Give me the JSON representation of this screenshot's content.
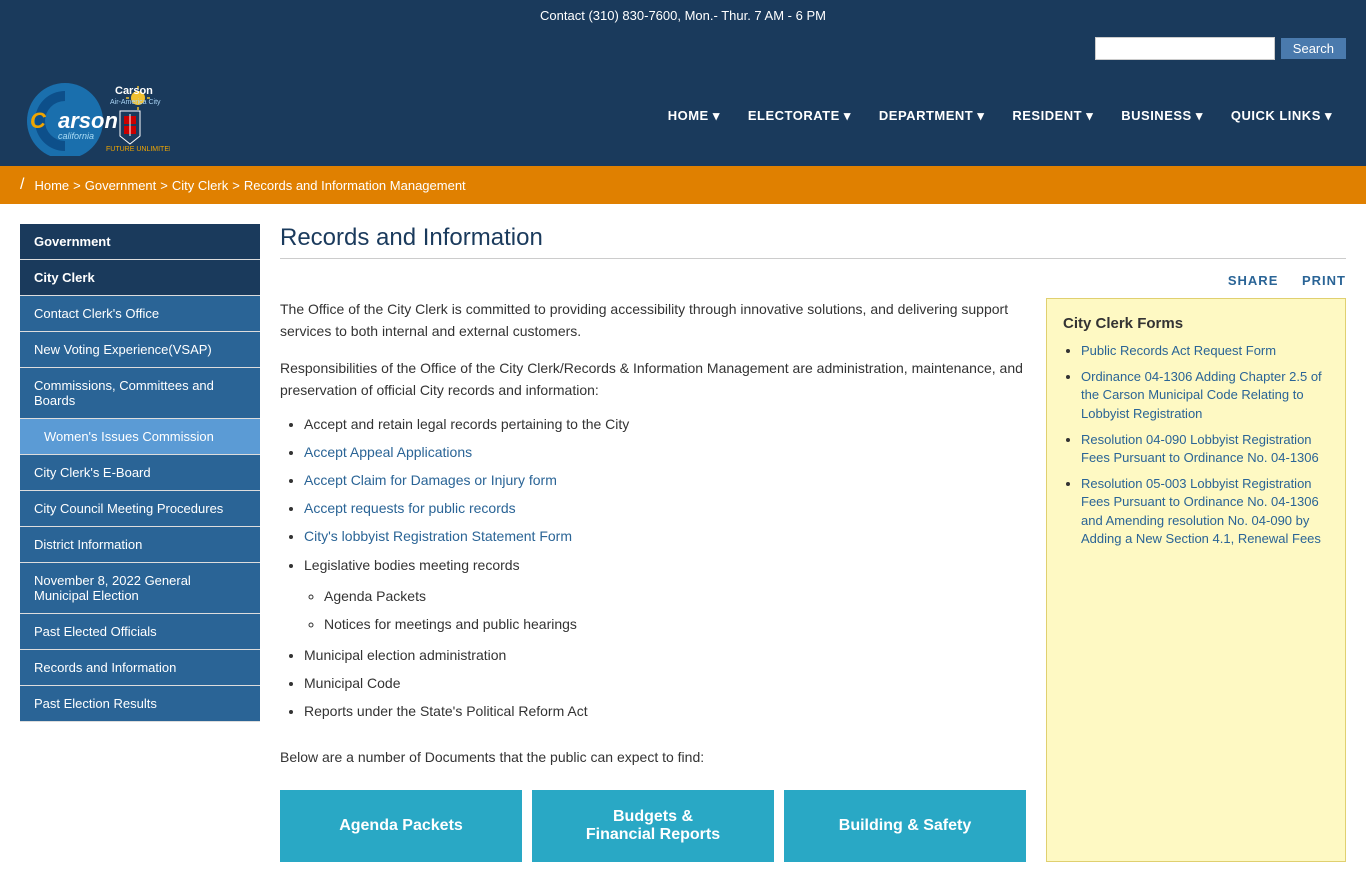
{
  "topbar": {
    "contact": "Contact (310) 830-7600, Mon.- Thur. 7 AM - 6 PM"
  },
  "search": {
    "placeholder": "",
    "button_label": "Search"
  },
  "nav": {
    "items": [
      {
        "label": "HOME □"
      },
      {
        "label": "ELECTORATE □"
      },
      {
        "label": "DEPARTMENT □"
      },
      {
        "label": "RESIDENT □"
      },
      {
        "label": "BUSINESS □"
      },
      {
        "label": "QUICK LINKS □"
      }
    ]
  },
  "breadcrumb": {
    "slash": "/",
    "items": [
      "Home",
      ">",
      "Government",
      ">",
      "City Clerk",
      ">",
      "Records and Information Management"
    ]
  },
  "sidebar": {
    "header": "Government",
    "items": [
      {
        "label": "City Clerk",
        "type": "active"
      },
      {
        "label": "Contact Clerk's Office",
        "type": "normal"
      },
      {
        "label": "New Voting Experience(VSAP)",
        "type": "normal"
      },
      {
        "label": "Commissions, Committees and Boards",
        "type": "normal"
      },
      {
        "label": "Women's Issues Commission",
        "type": "sub"
      },
      {
        "label": "City Clerk's E-Board",
        "type": "normal"
      },
      {
        "label": "City Council Meeting Procedures",
        "type": "normal"
      },
      {
        "label": "District Information",
        "type": "normal"
      },
      {
        "label": "November 8, 2022 General Municipal Election",
        "type": "normal"
      },
      {
        "label": "Past Elected Officials",
        "type": "normal"
      },
      {
        "label": "Records and Information",
        "type": "normal"
      },
      {
        "label": "Past Election Results",
        "type": "normal"
      }
    ]
  },
  "main": {
    "title": "Records and Information",
    "share_label": "SHARE",
    "print_label": "PRINT",
    "intro": "The Office of the City Clerk is committed to providing accessibility through innovative solutions, and delivering support services to both internal and external customers.",
    "responsibilities_intro": "Responsibilities of the Office of the City Clerk/Records & Information Management are administration, maintenance, and preservation of official City records and information:",
    "responsibilities": [
      {
        "text": "Accept and retain legal records pertaining to the City",
        "link": false
      },
      {
        "text": "Accept Appeal Applications",
        "link": true
      },
      {
        "text": "Accept Claim for Damages or Injury form",
        "link": true
      },
      {
        "text": "Accept requests for public records",
        "link": true
      },
      {
        "text": "City's lobbyist Registration Statement Form",
        "link": true
      },
      {
        "text": "Legislative bodies meeting records",
        "link": false,
        "sub": [
          "Agenda Packets",
          "Notices for meetings and public hearings"
        ]
      },
      {
        "text": "Municipal election administration",
        "link": false
      },
      {
        "text": "Municipal Code",
        "link": false
      },
      {
        "text": "Reports under the State's Political Reform Act",
        "link": false
      }
    ],
    "below_text": "Below are a number of Documents that the public can expect to find:",
    "forms_box": {
      "title": "City Clerk Forms",
      "items": [
        {
          "label": "Public Records Act Request Form",
          "href": "#"
        },
        {
          "label": "Ordinance 04-1306 Adding Chapter 2.5 of the Carson Municipal Code Relating to Lobbyist Registration",
          "href": "#"
        },
        {
          "label": "Resolution 04-090 Lobbyist Registration Fees Pursuant to Ordinance No. 04-1306",
          "href": "#"
        },
        {
          "label": "Resolution 05-003 Lobbyist Registration Fees Pursuant to Ordinance No. 04-1306 and Amending resolution No. 04-090 by Adding a New Section 4.1, Renewal Fees",
          "href": "#"
        }
      ]
    },
    "bottom_buttons": [
      {
        "label": "Agenda Packets"
      },
      {
        "label": "Budgets &\nFinancial Reports"
      },
      {
        "label": "Building & Safety"
      }
    ]
  },
  "logo": {
    "carson_text": "Carson",
    "california_text": "california",
    "sub_text": "Air-America City",
    "tagline": "FUTURE UNLIMITED"
  }
}
